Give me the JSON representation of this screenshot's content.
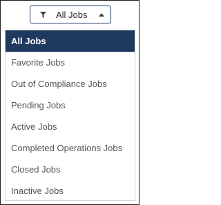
{
  "filter": {
    "label": "All Jobs",
    "icon": "filter-icon",
    "caret_icon": "caret-up-icon"
  },
  "menu": {
    "selected_index": 0,
    "items": [
      {
        "label": "All Jobs"
      },
      {
        "label": "Favorite Jobs"
      },
      {
        "label": "Out of Compliance Jobs"
      },
      {
        "label": "Pending Jobs"
      },
      {
        "label": "Active Jobs"
      },
      {
        "label": "Completed Operations Jobs"
      },
      {
        "label": "Closed Jobs"
      },
      {
        "label": "Inactive Jobs"
      }
    ]
  },
  "colors": {
    "selected_background": "#1f3a5f",
    "selected_text": "#ffffff",
    "item_text": "#555555",
    "button_border": "#1e3a5f"
  }
}
